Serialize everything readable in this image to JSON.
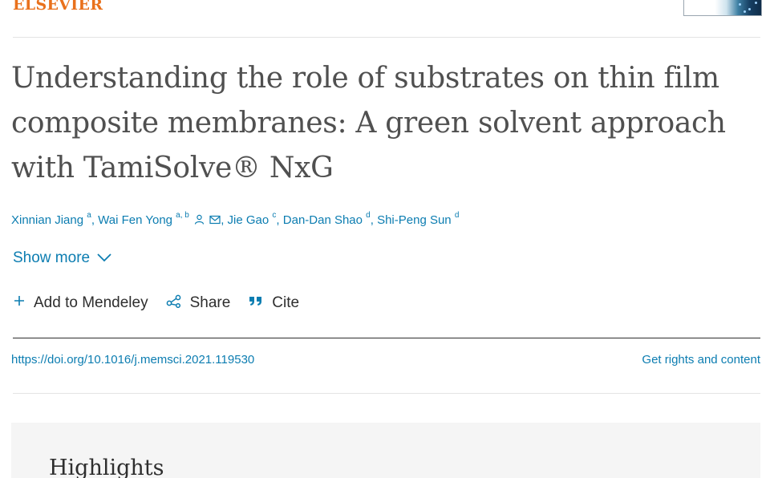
{
  "header": {
    "publisher": "ELSEVIER"
  },
  "article": {
    "title": "Understanding the role of substrates on thin film composite membranes: A green solvent approach with TamiSolve® NxG",
    "authors": [
      {
        "name": "Xinnian Jiang",
        "sup": "a"
      },
      {
        "name": "Wai Fen Yong",
        "sup": "a, b"
      },
      {
        "name": "Jie Gao",
        "sup": "c"
      },
      {
        "name": "Dan-Dan Shao",
        "sup": "d"
      },
      {
        "name": "Shi-Peng Sun",
        "sup": "d"
      }
    ],
    "show_more_label": "Show more",
    "actions": {
      "mendeley_label": "Add to Mendeley",
      "share_label": "Share",
      "cite_label": "Cite"
    },
    "doi": "https://doi.org/10.1016/j.memsci.2021.119530",
    "rights_label": "Get rights and content",
    "highlights_heading": "Highlights"
  },
  "colors": {
    "link": "#0c7db1",
    "publisher": "#e9711c",
    "text": "#2e2e2e"
  },
  "icons": {
    "add": "plus-icon",
    "share": "share-icon",
    "cite": "quote-icon",
    "show_more": "chevron-down-icon",
    "person": "person-icon",
    "email": "email-icon"
  }
}
